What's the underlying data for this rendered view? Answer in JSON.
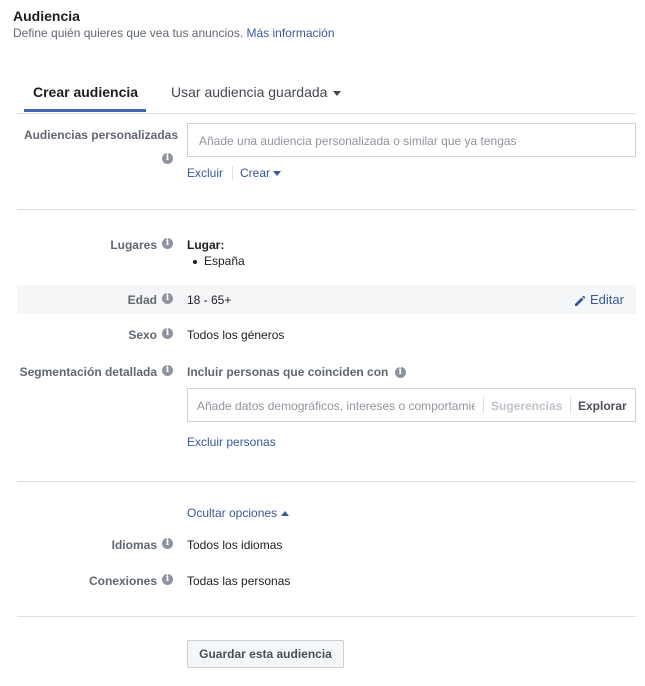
{
  "header": {
    "title": "Audiencia",
    "subtitle": "Define quién quieres que vea tus anuncios.",
    "more_link": "Más información"
  },
  "tabs": [
    {
      "label": "Crear audiencia",
      "active": true
    },
    {
      "label": "Usar audiencia guardada",
      "active": false
    }
  ],
  "custom_audiences": {
    "label": "Audiencias personalizadas",
    "placeholder": "Añade una audiencia personalizada o similar que ya tengas",
    "exclude_link": "Excluir",
    "create_link": "Crear"
  },
  "locations": {
    "label": "Lugares",
    "heading": "Lugar:",
    "items": [
      "España"
    ]
  },
  "age": {
    "label": "Edad",
    "value": "18 - 65+",
    "edit_label": "Editar"
  },
  "gender": {
    "label": "Sexo",
    "value": "Todos los géneros"
  },
  "detailed_targeting": {
    "label": "Segmentación detallada",
    "include_text": "Incluir personas que coinciden con",
    "placeholder": "Añade datos demográficos, intereses o comportamientos",
    "suggestions_label": "Sugerencias",
    "explore_label": "Explorar",
    "exclude_people_link": "Excluir personas"
  },
  "options": {
    "hide_options_link": "Ocultar opciones"
  },
  "languages": {
    "label": "Idiomas",
    "value": "Todos los idiomas"
  },
  "connections": {
    "label": "Conexiones",
    "value": "Todas las personas"
  },
  "save_button": "Guardar esta audiencia",
  "colors": {
    "accent": "#4267b2",
    "link": "#385898",
    "highlight_row": "#f5f6f7",
    "divider": "#dddfe2"
  }
}
